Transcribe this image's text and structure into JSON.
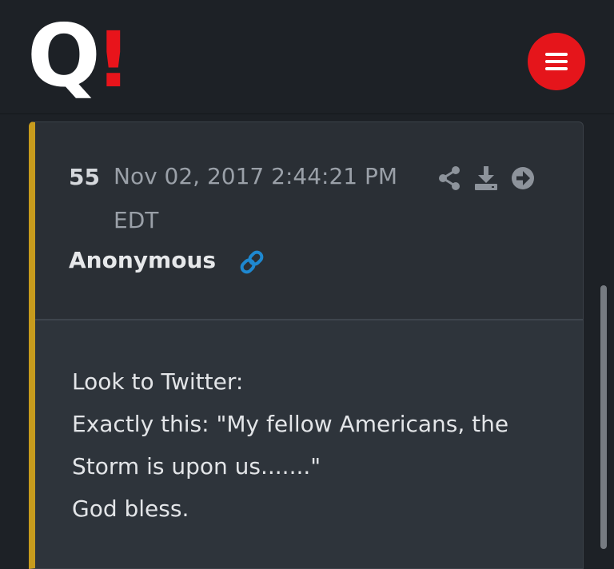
{
  "header": {
    "logo_letter": "Q",
    "logo_mark": "!",
    "menu_icon": "hamburger-icon"
  },
  "post": {
    "number": "55",
    "date": "Nov 02, 2017 2:44:21 PM EDT",
    "author": "Anonymous",
    "actions": [
      "share-icon",
      "download-icon",
      "arrow-right-icon"
    ],
    "link_icon": "link-icon",
    "lines": [
      "Look to Twitter:",
      "Exactly this: \"My fellow Americans, the",
      "Storm is upon us.......\"",
      "God bless."
    ]
  },
  "colors": {
    "accent": "#e5151b",
    "card_border_left": "#c79b1d",
    "link": "#1e88d0",
    "background": "#1d2126"
  }
}
